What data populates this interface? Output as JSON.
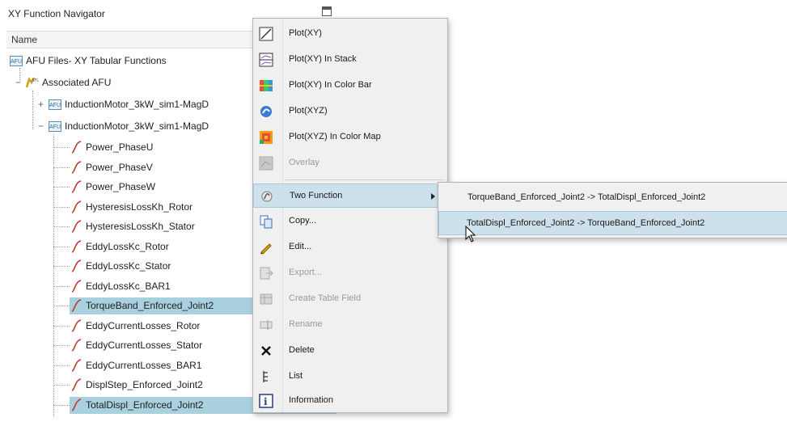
{
  "navigator": {
    "title": "XY Function Navigator",
    "column_header": "Name",
    "root": "AFU Files- XY Tabular Functions",
    "associated": "Associated AFU",
    "afu_files": [
      "InductionMotor_3kW_sim1-MagD",
      "InductionMotor_3kW_sim1-MagD"
    ],
    "functions": [
      "Power_PhaseU",
      "Power_PhaseV",
      "Power_PhaseW",
      "HysteresisLossKh_Rotor",
      "HysteresisLossKh_Stator",
      "EddyLossKc_Rotor",
      "EddyLossKc_Stator",
      "EddyLossKc_BAR1",
      "TorqueBand_Enforced_Joint2",
      "EddyCurrentLosses_Rotor",
      "EddyCurrentLosses_Stator",
      "EddyCurrentLosses_BAR1",
      "DisplStep_Enforced_Joint2",
      "TotalDispl_Enforced_Joint2"
    ],
    "selected": [
      "TorqueBand_Enforced_Joint2",
      "TotalDispl_Enforced_Joint2"
    ]
  },
  "context_menu": {
    "items": [
      {
        "label": "Plot(XY)",
        "icon": "plot-xy-icon",
        "enabled": true
      },
      {
        "label": "Plot(XY) In Stack",
        "icon": "plot-stack-icon",
        "enabled": true
      },
      {
        "label": "Plot(XY) In Color Bar",
        "icon": "color-bar-icon",
        "enabled": true
      },
      {
        "label": "Plot(XYZ)",
        "icon": "plot-xyz-icon",
        "enabled": true
      },
      {
        "label": "Plot(XYZ) In Color Map",
        "icon": "color-map-icon",
        "enabled": true
      },
      {
        "label": "Overlay",
        "icon": "overlay-icon",
        "enabled": false
      },
      {
        "label": "Two Function",
        "icon": "two-function-icon",
        "enabled": true,
        "submenu": true,
        "highlighted": true
      },
      {
        "label": "Copy...",
        "icon": "copy-icon",
        "enabled": true
      },
      {
        "label": "Edit...",
        "icon": "edit-icon",
        "enabled": true
      },
      {
        "label": "Export...",
        "icon": "export-icon",
        "enabled": false
      },
      {
        "label": "Create Table Field",
        "icon": "table-field-icon",
        "enabled": false
      },
      {
        "label": "Rename",
        "icon": "rename-icon",
        "enabled": false
      },
      {
        "label": "Delete",
        "icon": "delete-icon",
        "enabled": true
      },
      {
        "label": "List",
        "icon": "list-icon",
        "enabled": true
      },
      {
        "label": "Information",
        "icon": "information-icon",
        "enabled": true
      }
    ]
  },
  "submenu": {
    "items": [
      {
        "label": "TorqueBand_Enforced_Joint2 -> TotalDispl_Enforced_Joint2"
      },
      {
        "label": "TotalDispl_Enforced_Joint2 -> TorqueBand_Enforced_Joint2",
        "highlighted": true
      }
    ]
  },
  "colors": {
    "selection": "#a9d0de",
    "menu_highlight": "#cce1ec",
    "function_curve": "#c0392b"
  }
}
